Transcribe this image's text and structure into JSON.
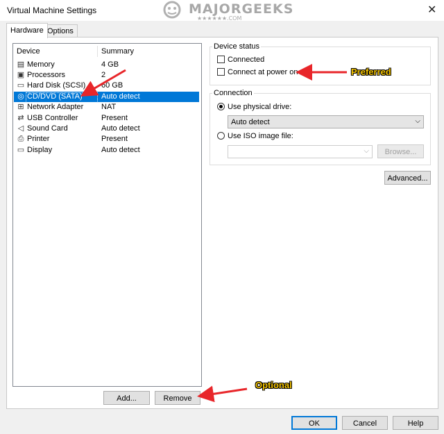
{
  "window": {
    "title": "Virtual Machine Settings",
    "close_glyph": "✕"
  },
  "watermark": {
    "main": "MAJORGEEKS",
    "sub": "★★★★★★.COM"
  },
  "tabs": [
    {
      "label": "Hardware",
      "active": true
    },
    {
      "label": "Options",
      "active": false
    }
  ],
  "device_list": {
    "columns": {
      "device": "Device",
      "summary": "Summary"
    },
    "rows": [
      {
        "icon": "memory-icon",
        "glyph": "▤",
        "name": "Memory",
        "summary": "4 GB",
        "selected": false
      },
      {
        "icon": "processor-icon",
        "glyph": "▣",
        "name": "Processors",
        "summary": "2",
        "selected": false
      },
      {
        "icon": "hard-disk-icon",
        "glyph": "▭",
        "name": "Hard Disk (SCSI)",
        "summary": "60 GB",
        "selected": false
      },
      {
        "icon": "cd-dvd-icon",
        "glyph": "◎",
        "name": "CD/DVD (SATA)",
        "summary": "Auto detect",
        "selected": true
      },
      {
        "icon": "network-adapter-icon",
        "glyph": "⊞",
        "name": "Network Adapter",
        "summary": "NAT",
        "selected": false
      },
      {
        "icon": "usb-controller-icon",
        "glyph": "⇄",
        "name": "USB Controller",
        "summary": "Present",
        "selected": false
      },
      {
        "icon": "sound-card-icon",
        "glyph": "◁",
        "name": "Sound Card",
        "summary": "Auto detect",
        "selected": false
      },
      {
        "icon": "printer-icon",
        "glyph": "⎙",
        "name": "Printer",
        "summary": "Present",
        "selected": false
      },
      {
        "icon": "display-icon",
        "glyph": "▭",
        "name": "Display",
        "summary": "Auto detect",
        "selected": false
      }
    ]
  },
  "list_buttons": {
    "add": "Add...",
    "remove": "Remove"
  },
  "device_status": {
    "legend": "Device status",
    "connected": {
      "label": "Connected",
      "checked": false
    },
    "connect_at_power_on": {
      "label": "Connect at power on",
      "checked": false
    }
  },
  "connection": {
    "legend": "Connection",
    "use_physical_drive": {
      "label": "Use physical drive:",
      "selected": true
    },
    "physical_drive_value": "Auto detect",
    "use_iso": {
      "label": "Use ISO image file:",
      "selected": false
    },
    "iso_value": "",
    "browse": "Browse...",
    "advanced": "Advanced..."
  },
  "footer": {
    "ok": "OK",
    "cancel": "Cancel",
    "help": "Help"
  },
  "annotations": {
    "preferred": "Preferred",
    "optional": "Optional"
  },
  "colors": {
    "selection": "#0078d7",
    "arrow": "#e8262a",
    "annotation_text": "#f5c400"
  }
}
